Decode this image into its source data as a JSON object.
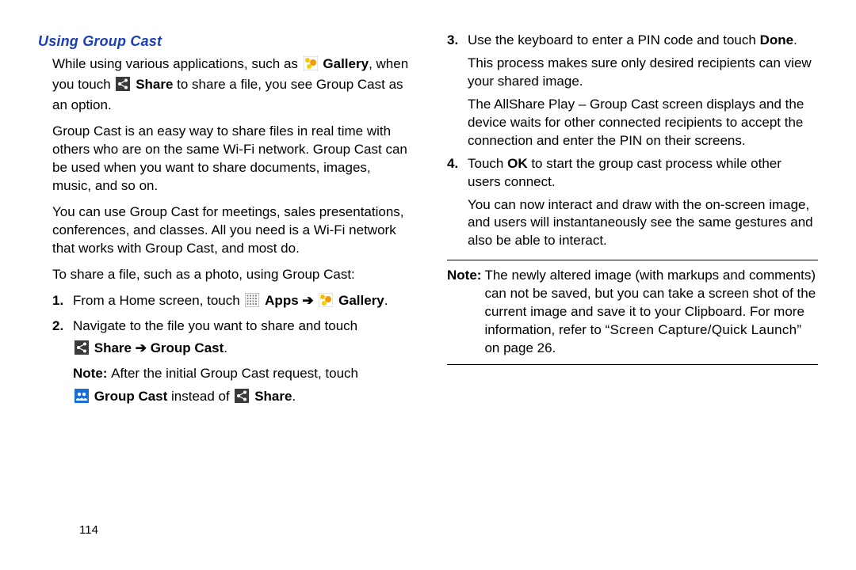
{
  "heading": "Using Group Cast",
  "p1_pre": "While using various applications, such as ",
  "p1_gallery": "Gallery",
  "p1_mid": ", when you touch ",
  "p1_share": "Share",
  "p1_post": " to share a file, you see Group Cast as an option.",
  "p2": "Group Cast is an easy way to share files in real time with others who are on the same Wi-Fi network. Group Cast can be used when you want to share documents, images, music, and so on.",
  "p3": "You can use Group Cast for meetings, sales presentations, conferences, and classes. All you need is a Wi-Fi network that works with Group Cast, and most do.",
  "p4": "To share a file, such as a photo, using Group Cast:",
  "step1": {
    "num": "1.",
    "pre": "From a Home screen, touch ",
    "apps": "Apps",
    "arrow": "➔",
    "gallery": "Gallery",
    "end": "."
  },
  "step2": {
    "num": "2.",
    "line1": "Navigate to the file you want to share and touch",
    "share": "Share",
    "arrow": "➔",
    "gcast": "Group Cast",
    "end": ".",
    "note_pre": "Note: ",
    "note_text": "After the initial Group Cast request, touch",
    "gcast2": "Group Cast",
    "instead": " instead of ",
    "share2": "Share",
    "end2": "."
  },
  "step3": {
    "num": "3.",
    "l1_pre": "Use the keyboard to enter a PIN code and touch ",
    "done": "Done",
    "l1_post": ".",
    "l2": "This process makes sure only desired recipients can view your shared image.",
    "l3": "The AllShare Play – Group Cast screen displays and the device waits for other connected recipients to accept the connection and enter the PIN on their screens."
  },
  "step4": {
    "num": "4.",
    "l1_pre": "Touch ",
    "ok": "OK",
    "l1_post": " to start the group cast process while other users connect.",
    "l2": "You can now interact and draw with the on-screen image, and users will instantaneously see the same gestures and also be able to interact."
  },
  "note": {
    "label": "Note:",
    "body_pre": "The newly altered image (with markups and comments) can not be saved, but you can take a screen shot of the current image and save it to your Clipboard. For more information, refer to ",
    "ref": "“Screen Capture/Quick Launch”",
    "body_post": " on page 26."
  },
  "page_number": "114"
}
